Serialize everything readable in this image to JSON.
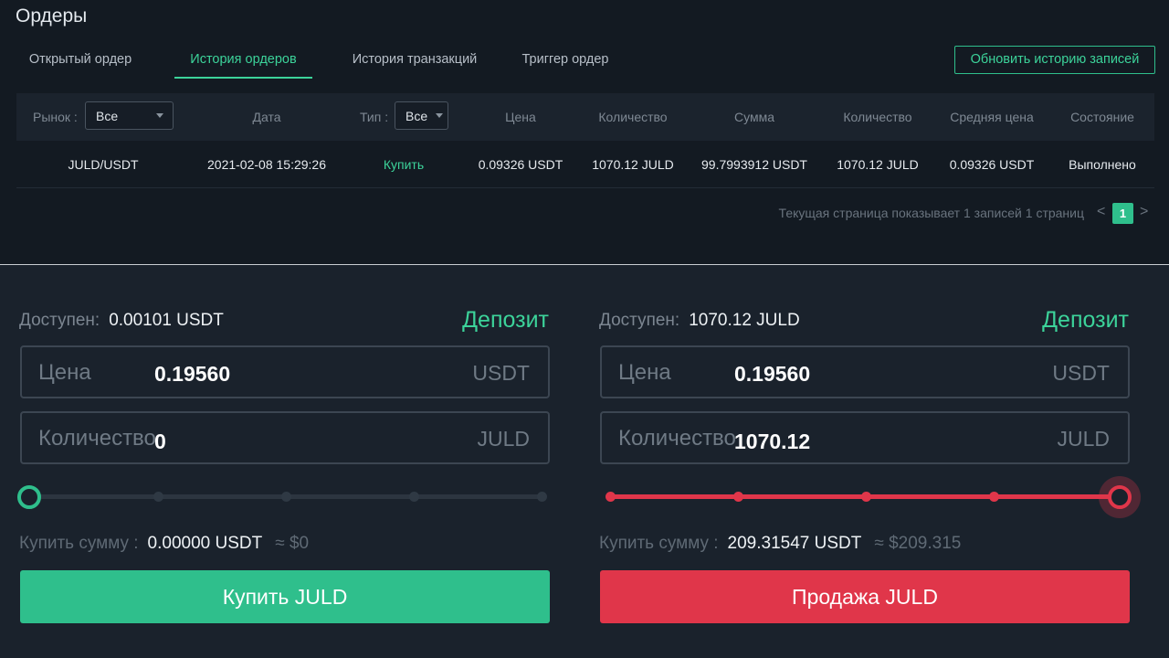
{
  "orders": {
    "title": "Ордеры",
    "tabs": [
      "Открытый ордер",
      "История ордеров",
      "История транзакций",
      "Триггер ордер"
    ],
    "active_tab": "История ордеров",
    "refresh_label": "Обновить историю записей",
    "filters": {
      "market_label": "Рынок :",
      "market_value": "Все",
      "type_label": "Тип :",
      "type_value": "Все"
    },
    "columns": [
      "Дата",
      "Цена",
      "Количество",
      "Сумма",
      "Количество",
      "Средняя цена",
      "Состояние"
    ],
    "rows": [
      {
        "market": "JULD/USDT",
        "date": "2021-02-08 15:29:26",
        "type": "Купить",
        "price": "0.09326 USDT",
        "amount": "1070.12 JULD",
        "total": "99.7993912 USDT",
        "filled": "1070.12 JULD",
        "avg_price": "0.09326 USDT",
        "status": "Выполнено"
      }
    ],
    "pagination": {
      "info": "Текущая страница показывает 1 записей 1 страниц",
      "prev": "<",
      "current": "1",
      "next": ">"
    }
  },
  "buy": {
    "available_label": "Доступен:",
    "available_value": "0.00101 USDT",
    "deposit_label": "Депозит",
    "price_label": "Цена",
    "price_value": "0.19560",
    "price_unit": "USDT",
    "qty_label": "Количество",
    "qty_value": "0",
    "qty_unit": "JULD",
    "slider_percent": 0,
    "sum_label": "Купить сумму :",
    "sum_value": "0.00000 USDT",
    "sum_usd": "≈ $0",
    "button_label": "Купить JULD"
  },
  "sell": {
    "available_label": "Доступен:",
    "available_value": "1070.12 JULD",
    "deposit_label": "Депозит",
    "price_label": "Цена",
    "price_value": "0.19560",
    "price_unit": "USDT",
    "qty_label": "Количество",
    "qty_value": "1070.12",
    "qty_unit": "JULD",
    "slider_percent": 100,
    "sum_label": "Купить сумму :",
    "sum_value": "209.31547 USDT",
    "sum_usd": "≈ $209.315",
    "button_label": "Продажа JULD"
  },
  "colors": {
    "accent_green": "#2fbf8c",
    "accent_red": "#e0364a",
    "panel_bg": "#131a22",
    "trade_bg": "#1a222c"
  }
}
